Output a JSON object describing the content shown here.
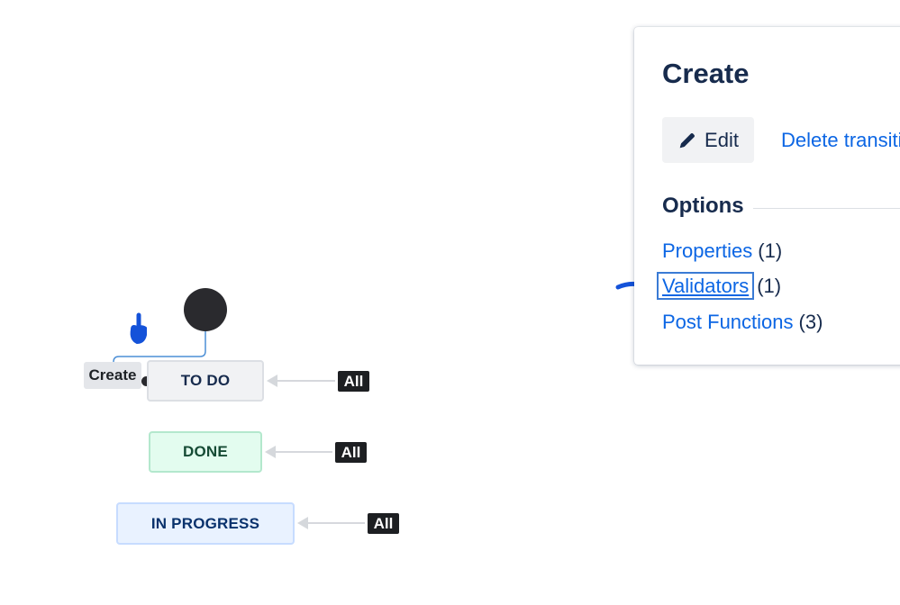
{
  "workflow": {
    "transition_label": "Create",
    "statuses": [
      {
        "label": "TO DO",
        "category": "todo"
      },
      {
        "label": "DONE",
        "category": "done"
      },
      {
        "label": "IN PROGRESS",
        "category": "inprogress"
      }
    ],
    "all_badges": [
      "All",
      "All",
      "All"
    ]
  },
  "panel": {
    "title": "Create",
    "edit_label": "Edit",
    "delete_label": "Delete transition",
    "options_heading": "Options",
    "options": [
      {
        "label": "Properties",
        "count": "(1)"
      },
      {
        "label": "Validators",
        "count": "(1)"
      },
      {
        "label": "Post Functions",
        "count": "(3)"
      }
    ]
  },
  "colors": {
    "link": "#0c66e4",
    "annotation": "#1452d9",
    "todo_bg": "#f1f2f4",
    "done_bg": "#e3fcef",
    "inprogress_bg": "#e9f2ff"
  }
}
